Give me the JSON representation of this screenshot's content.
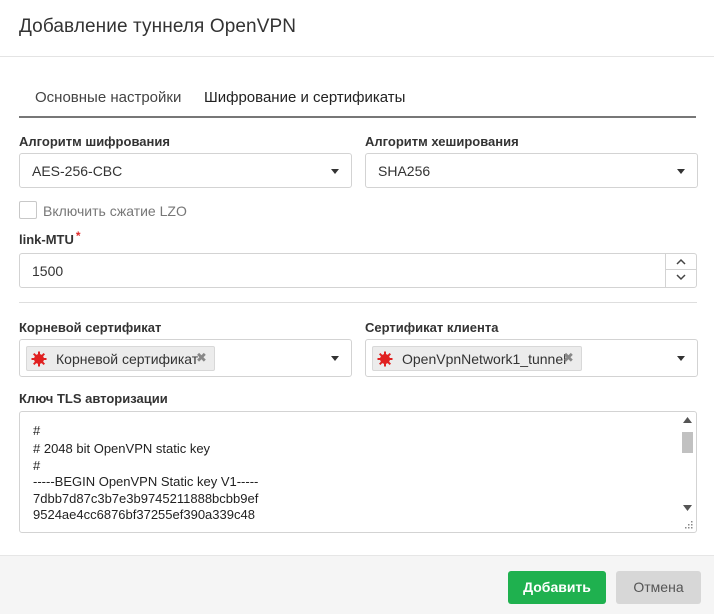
{
  "dialog": {
    "title": "Добавление туннеля OpenVPN"
  },
  "tabs": [
    {
      "label": "Основные настройки",
      "active": false
    },
    {
      "label": "Шифрование и сертификаты",
      "active": true
    }
  ],
  "cipher": {
    "label": "Алгоритм шифрования",
    "value": "AES-256-CBC"
  },
  "hash": {
    "label": "Алгоритм хеширования",
    "value": "SHA256"
  },
  "lzo": {
    "label": "Включить сжатие LZO",
    "checked": false
  },
  "link_mtu": {
    "label": "link-MTU",
    "required_mark": "*",
    "value": "1500"
  },
  "root_cert": {
    "label": "Корневой сертификат",
    "tag": "Корневой сертификат",
    "remove_glyph": "✖"
  },
  "client_cert": {
    "label": "Сертификат клиента",
    "tag": "OpenVpnNetwork1_tunnel",
    "remove_glyph": "✖"
  },
  "tls_key": {
    "label": "Ключ TLS авторизации",
    "lines": [
      "#",
      "# 2048 bit OpenVPN static key",
      "#",
      "-----BEGIN OpenVPN Static key V1-----",
      "7dbb7d87c3b7e3b9745211888bcbb9ef",
      "9524ae4cc6876bf37255ef390a339c48"
    ]
  },
  "footer": {
    "add_label": "Добавить",
    "cancel_label": "Отмена"
  },
  "colors": {
    "primary": "#1fb14f",
    "cert_icon": "#e02020",
    "required": "#e02a2a",
    "tab_underline": "#777777"
  }
}
